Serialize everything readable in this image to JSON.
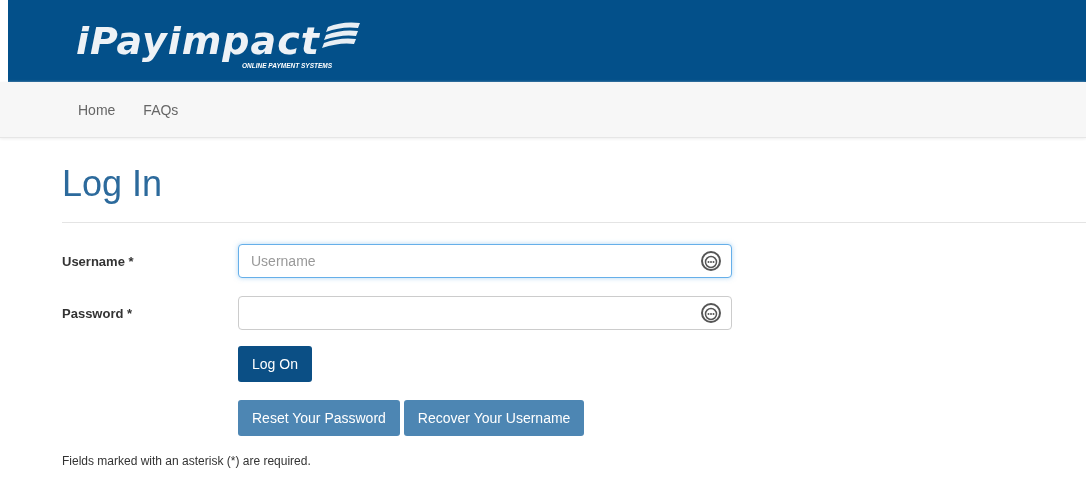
{
  "header": {
    "logo": "iPayimpact",
    "tagline": "ONLINE PAYMENT SYSTEMS"
  },
  "nav": [
    "Home",
    "FAQs"
  ],
  "title": "Log In",
  "fields": [
    {
      "label": "Username *",
      "placeholder": "Username",
      "focused": true
    },
    {
      "label": "Password *",
      "focused": false
    }
  ],
  "submit": "Log On",
  "links": [
    "Reset Your Password",
    "Recover Your Username"
  ],
  "note": "Fields marked with an asterisk (*) are required."
}
